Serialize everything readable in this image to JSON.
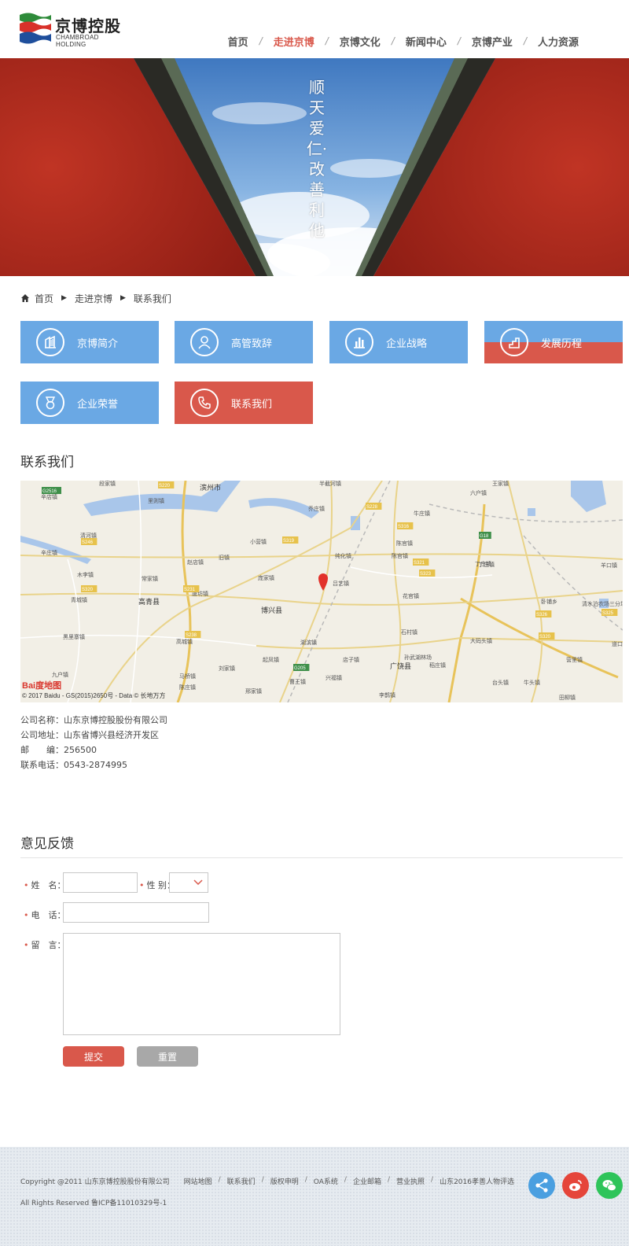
{
  "header": {
    "logo_cn": "京博控股",
    "logo_en": "CHAMBROAD HOLDING",
    "nav": [
      {
        "label": "首页"
      },
      {
        "label": "走进京博"
      },
      {
        "label": "京博文化"
      },
      {
        "label": "新闻中心"
      },
      {
        "label": "京博产业"
      },
      {
        "label": "人力资源"
      }
    ],
    "active_nav": "走进京博"
  },
  "banner": {
    "slogan": "顺天爱仁·改善利他"
  },
  "breadcrumb": {
    "items": [
      "首页",
      "走进京博",
      "联系我们"
    ]
  },
  "tiles": [
    {
      "label": "京博简介",
      "icon": "building-icon"
    },
    {
      "label": "高管致辞",
      "icon": "person-icon"
    },
    {
      "label": "企业战略",
      "icon": "bar-chart-icon"
    },
    {
      "label": "发展历程",
      "icon": "steps-icon"
    },
    {
      "label": "企业荣誉",
      "icon": "medal-icon"
    },
    {
      "label": "联系我们",
      "icon": "phone-icon"
    }
  ],
  "contact": {
    "title": "联系我们",
    "map": {
      "copyright": "© 2017 Baidu - GS(2015)2650号 - Data © 长地万方",
      "logo": "Bai度地图",
      "labels": [
        "滨州市",
        "博兴县",
        "高青县",
        "广饶县",
        "湖滨镇",
        "吕艺镇",
        "乔庄镇",
        "纯化镇",
        "陈官镇",
        "丁庄镇",
        "六户镇",
        "石村镇",
        "店子镇",
        "兴福镇",
        "曹王镇",
        "李鹊镇",
        "花官镇",
        "大码头镇",
        "高城镇",
        "唐坊镇",
        "里则镇",
        "清河镇",
        "木李镇",
        "青城镇",
        "黑里寨镇",
        "九户镇",
        "马桥镇",
        "陈庄镇",
        "小营镇",
        "辛庄镇",
        "旧镇",
        "赵店镇",
        "常家镇",
        "庞家镇",
        "起凤镇",
        "孙武湖林场",
        "稻庄镇",
        "台头镇",
        "牛头镇",
        "营里镇",
        "卧铺乡",
        "清水泊农场三分场",
        "羊口镇",
        "道口",
        "田柳镇",
        "丁庄镇",
        "辛店镇",
        "刘家镇",
        "邢家镇",
        "陈官镇",
        "牛庄镇",
        "半截河镇",
        "段家镇",
        "王家镇"
      ],
      "roads": [
        "G2516",
        "S220",
        "S228",
        "S316",
        "S319",
        "S321",
        "S323",
        "S231",
        "S238",
        "S246",
        "S320",
        "S326",
        "G18",
        "G205",
        "S320",
        "S325"
      ]
    },
    "info": [
      {
        "label": "公司名称：",
        "value": "山东京博控股股份有限公司"
      },
      {
        "label": "公司地址：",
        "value": "山东省博兴县经济开发区"
      },
      {
        "label": "邮　　编：",
        "value": "256500"
      },
      {
        "label": "联系电话：",
        "value": "0543-2874995"
      }
    ]
  },
  "feedback": {
    "title": "意见反馈",
    "name_label": "姓　名：",
    "gender_label": "性 别：",
    "phone_label": "电　话：",
    "message_label": "留　言：",
    "submit": "提交",
    "reset": "重置"
  },
  "footer": {
    "copyright": "Copyright @2011 山东京博控股股份有限公司",
    "links": [
      "网站地图",
      "联系我们",
      "版权申明",
      "OA系统",
      "企业邮箱",
      "营业执照",
      "山东2016孝善人物评选"
    ],
    "rights": "All Rights Reserved 鲁ICP备11010329号-1",
    "social": [
      {
        "icon": "share-icon",
        "color": "#4a9fe0"
      },
      {
        "icon": "weibo-icon",
        "color": "#e5453a"
      },
      {
        "icon": "wechat-icon",
        "color": "#2ec45a"
      }
    ]
  },
  "colors": {
    "accent": "#d9584b",
    "tile_blue": "#6aa8e4",
    "reset_gray": "#a8a8a8"
  }
}
